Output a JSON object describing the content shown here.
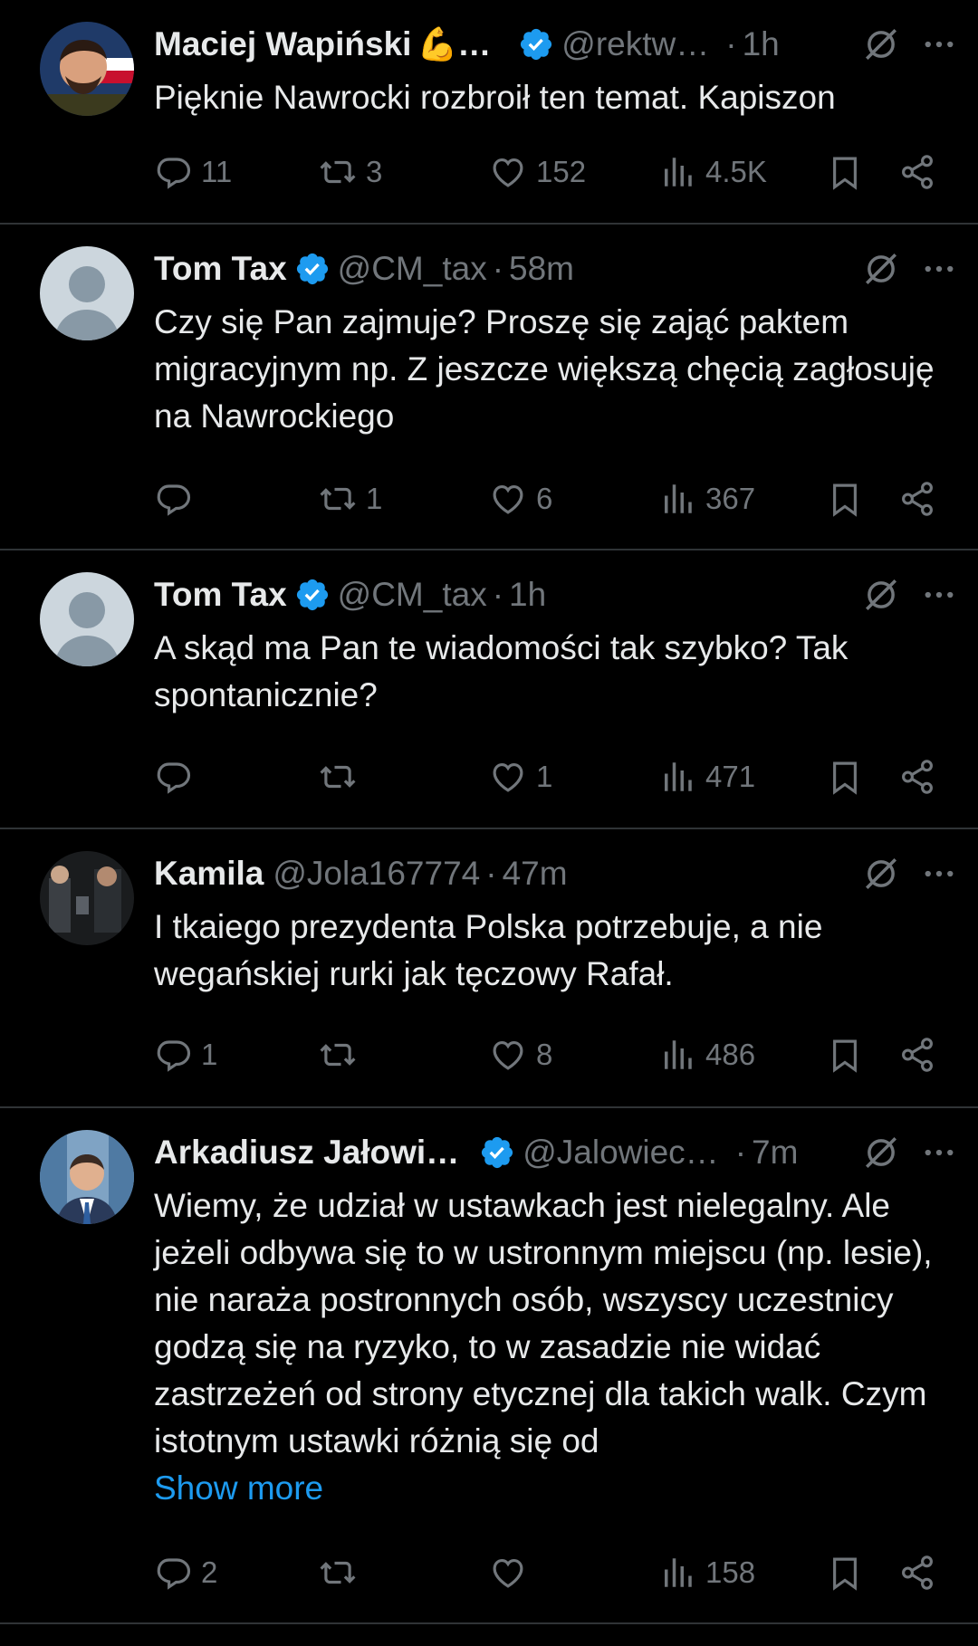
{
  "tweets": [
    {
      "name": "Maciej Wapiński",
      "name_emoji": "💪",
      "name_ellipsis": "…",
      "handle": "@rektw…",
      "time": "1h",
      "text": "Pięknie Nawrocki rozbroił ten temat. Kapiszon",
      "replies": "11",
      "reposts": "3",
      "likes": "152",
      "views": "4.5K",
      "avatar_icon": "profile-photo-man-with-flag"
    },
    {
      "name": "Tom Tax",
      "handle": "@CM_tax",
      "time": "58m",
      "text": "Czy się Pan zajmuje? Proszę się zająć paktem migracyjnym np. Z jeszcze większą chęcią zagłosuję na Nawrockiego",
      "replies": "",
      "reposts": "1",
      "likes": "6",
      "views": "367",
      "avatar_icon": "default-avatar"
    },
    {
      "name": "Tom Tax",
      "handle": "@CM_tax",
      "time": "1h",
      "text": "A skąd ma Pan te wiadomości tak szybko? Tak spontanicznie?",
      "replies": "",
      "reposts": "",
      "likes": "1",
      "views": "471",
      "avatar_icon": "default-avatar"
    },
    {
      "name": "Kamila",
      "handle": "@Jola167774",
      "time": "47m",
      "text": "I tkaiego prezydenta Polska potrzebuje, a nie wegańskiej rurki jak tęczowy Rafał.",
      "replies": "1",
      "reposts": "",
      "likes": "8",
      "views": "486",
      "avatar_icon": "profile-photo-dark"
    },
    {
      "name": "Arkadiusz Jałowi…",
      "handle": "@Jalowiec…",
      "time": "7m",
      "text": "Wiemy, że udział w ustawkach jest nielegalny. Ale jeżeli odbywa się to w ustronnym miejscu (np. lesie), nie naraża postronnych osób, wszyscy uczestnicy godzą się na ryzyko, to w zasadzie nie widać zastrzeżeń od strony etycznej dla takich walk. Czym istotnym ustawki różnią się od",
      "show_more": "Show more",
      "replies": "2",
      "reposts": "",
      "likes": "",
      "views": "158",
      "avatar_icon": "profile-photo-man-in-suit"
    }
  ],
  "colors": {
    "background": "#000000",
    "text": "#e7e9ea",
    "muted": "#71767b",
    "accent": "#1d9bf0",
    "divider": "#2f3336"
  }
}
